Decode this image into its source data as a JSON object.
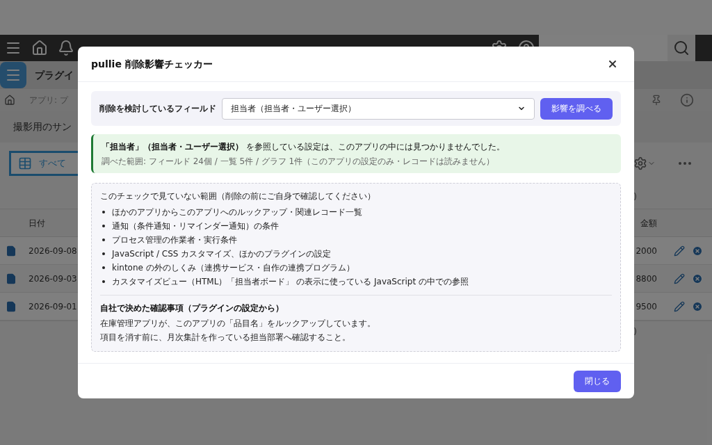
{
  "app": {
    "title": "プラグイ",
    "breadcrumb": "アプリ: プ",
    "subtitle": "撮影用のサン",
    "view": "すべて"
  },
  "table": {
    "columns": [
      "日付",
      "金額"
    ],
    "rows": [
      {
        "date": "2026-09-08",
        "amount": "2000"
      },
      {
        "date": "2026-09-03",
        "amount": "8800"
      },
      {
        "date": "2026-09-01",
        "amount": "9500"
      }
    ],
    "top_note": ")",
    "bottom_note": ")"
  },
  "dialog": {
    "title": "pullie 削除影響チェッカー",
    "field_label": "削除を検討しているフィールド",
    "field_value": "担当者（担当者・ユーザー選択）",
    "check_button": "影響を調べる",
    "result": {
      "lead": "**「担当者」（担当者・ユーザー選択）** を参照している設定は、このアプリの中には見つかりませんでした。",
      "detail": "調べた範囲: フィールド 24個 / 一覧 5件 / グラフ 1件（このアプリの設定のみ・レコードは読みません）"
    },
    "not_checked": {
      "heading": "このチェックで見ていない範囲（削除の前にご自身で確認してください）",
      "items": [
        "ほかのアプリからこのアプリへのルックアップ・関連レコード一覧",
        "通知（条件通知・リマインダー通知）の条件",
        "プロセス管理の作業者・実行条件",
        "JavaScript / CSS カスタマイズ、ほかのプラグインの設定",
        "kintone の外のしくみ（連携サービス・自作の連携プログラム）",
        "カスタマイズビュー（HTML）「担当者ボード」 の表示に使っている JavaScript の中での参照"
      ]
    },
    "custom": {
      "heading": "自社で決めた確認事項（プラグインの設定から）",
      "lines": [
        "在庫管理アプリが、このアプリの「品目名」をルックアップしています。",
        "項目を消す前に、月次集計を作っている担当部署へ確認すること。"
      ]
    },
    "close_button": "閉じる"
  }
}
